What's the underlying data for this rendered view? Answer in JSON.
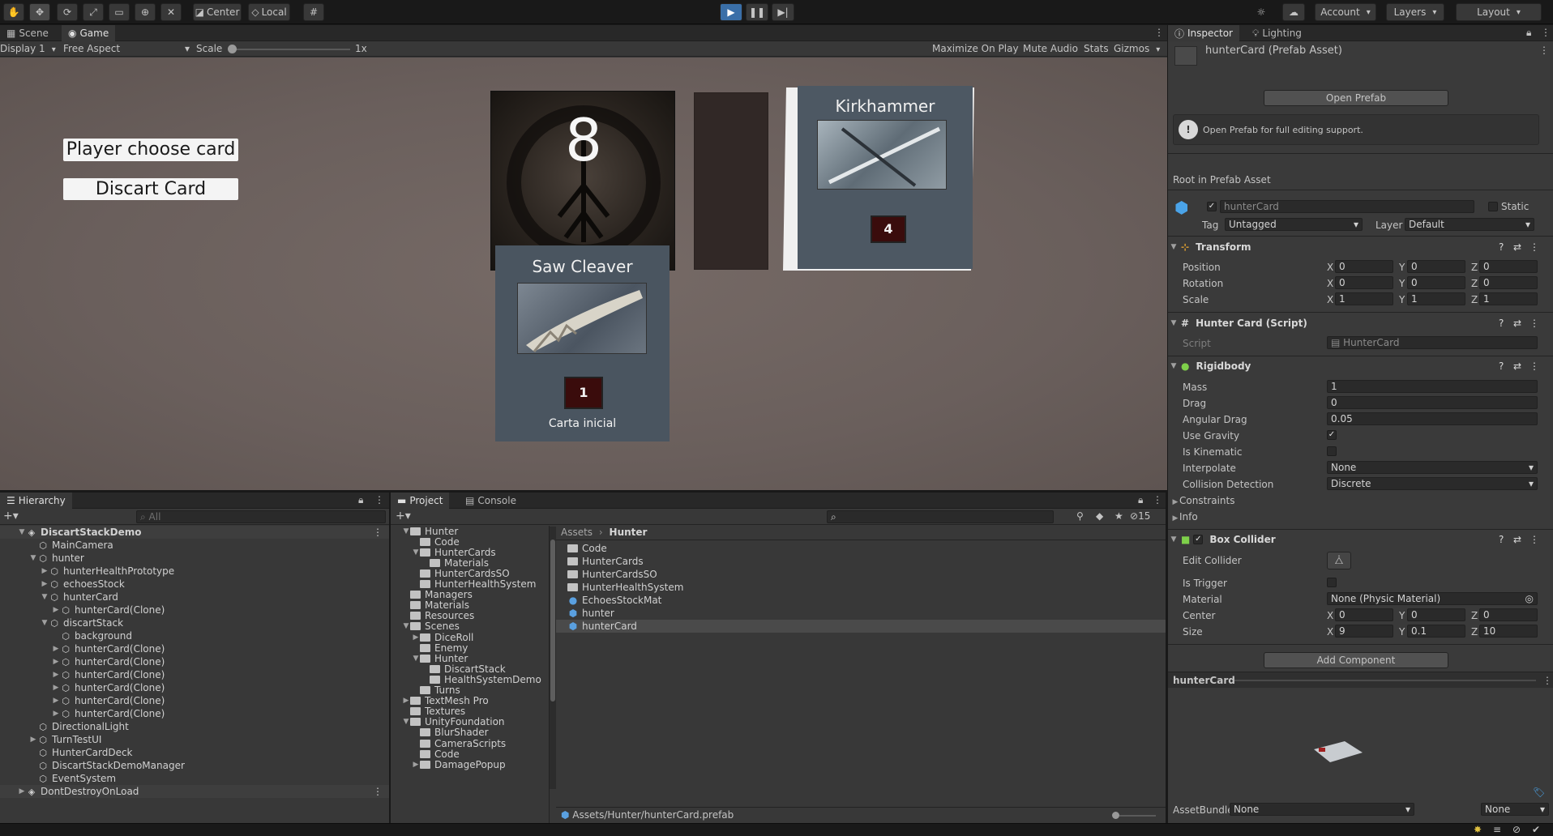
{
  "toolbar": {
    "pivot_center": "Center",
    "pivot_local": "Local",
    "account": "Account",
    "layers": "Layers",
    "layout": "Layout"
  },
  "scene_tabs": {
    "scene": "Scene",
    "game": "Game"
  },
  "game_bar": {
    "display": "Display 1",
    "aspect": "Free Aspect",
    "scale_label": "Scale",
    "scale_value": "1x",
    "maximize": "Maximize On Play",
    "mute": "Mute Audio",
    "stats": "Stats",
    "gizmos": "Gizmos"
  },
  "game_view": {
    "btn_player": "Player choose card",
    "btn_discard": "Discart Card",
    "deck_count": "8",
    "card_kirk": {
      "title": "Kirkhammer",
      "cost": "4"
    },
    "card_saw": {
      "title": "Saw Cleaver",
      "cost": "1",
      "subtitle": "Carta inicial"
    }
  },
  "hierarchy": {
    "tab": "Hierarchy",
    "search_placeholder": "All",
    "items": [
      {
        "label": "DiscartStackDemo",
        "depth": 0,
        "arrow": "▼",
        "kind": "scene",
        "bold": true
      },
      {
        "label": "MainCamera",
        "depth": 1,
        "arrow": "",
        "kind": "cube"
      },
      {
        "label": "hunter",
        "depth": 1,
        "arrow": "▼",
        "kind": "cube"
      },
      {
        "label": "hunterHealthPrototype",
        "depth": 2,
        "arrow": "▶",
        "kind": "cube"
      },
      {
        "label": "echoesStock",
        "depth": 2,
        "arrow": "▶",
        "kind": "cube"
      },
      {
        "label": "hunterCard",
        "depth": 2,
        "arrow": "▼",
        "kind": "cube"
      },
      {
        "label": "hunterCard(Clone)",
        "depth": 3,
        "arrow": "▶",
        "kind": "cube"
      },
      {
        "label": "discartStack",
        "depth": 2,
        "arrow": "▼",
        "kind": "cube"
      },
      {
        "label": "background",
        "depth": 3,
        "arrow": "",
        "kind": "cube"
      },
      {
        "label": "hunterCard(Clone)",
        "depth": 3,
        "arrow": "▶",
        "kind": "cube"
      },
      {
        "label": "hunterCard(Clone)",
        "depth": 3,
        "arrow": "▶",
        "kind": "cube"
      },
      {
        "label": "hunterCard(Clone)",
        "depth": 3,
        "arrow": "▶",
        "kind": "cube"
      },
      {
        "label": "hunterCard(Clone)",
        "depth": 3,
        "arrow": "▶",
        "kind": "cube"
      },
      {
        "label": "hunterCard(Clone)",
        "depth": 3,
        "arrow": "▶",
        "kind": "cube"
      },
      {
        "label": "hunterCard(Clone)",
        "depth": 3,
        "arrow": "▶",
        "kind": "cube"
      },
      {
        "label": "DirectionalLight",
        "depth": 1,
        "arrow": "",
        "kind": "cube"
      },
      {
        "label": "TurnTestUI",
        "depth": 1,
        "arrow": "▶",
        "kind": "cube"
      },
      {
        "label": "HunterCardDeck",
        "depth": 1,
        "arrow": "",
        "kind": "cube"
      },
      {
        "label": "DiscartStackDemoManager",
        "depth": 1,
        "arrow": "",
        "kind": "cube"
      },
      {
        "label": "EventSystem",
        "depth": 1,
        "arrow": "",
        "kind": "cube"
      },
      {
        "label": "DontDestroyOnLoad",
        "depth": 0,
        "arrow": "▶",
        "kind": "scene"
      }
    ]
  },
  "project": {
    "tab": "Project",
    "console_tab": "Console",
    "hidden_count": "15",
    "tree": [
      {
        "label": "Hunter",
        "depth": 0,
        "arrow": "▼"
      },
      {
        "label": "Code",
        "depth": 1,
        "arrow": ""
      },
      {
        "label": "HunterCards",
        "depth": 1,
        "arrow": "▼"
      },
      {
        "label": "Materials",
        "depth": 2,
        "arrow": ""
      },
      {
        "label": "HunterCardsSO",
        "depth": 1,
        "arrow": ""
      },
      {
        "label": "HunterHealthSystem",
        "depth": 1,
        "arrow": ""
      },
      {
        "label": "Managers",
        "depth": 0,
        "arrow": ""
      },
      {
        "label": "Materials",
        "depth": 0,
        "arrow": ""
      },
      {
        "label": "Resources",
        "depth": 0,
        "arrow": ""
      },
      {
        "label": "Scenes",
        "depth": 0,
        "arrow": "▼"
      },
      {
        "label": "DiceRoll",
        "depth": 1,
        "arrow": "▶"
      },
      {
        "label": "Enemy",
        "depth": 1,
        "arrow": ""
      },
      {
        "label": "Hunter",
        "depth": 1,
        "arrow": "▼"
      },
      {
        "label": "DiscartStack",
        "depth": 2,
        "arrow": ""
      },
      {
        "label": "HealthSystemDemo",
        "depth": 2,
        "arrow": ""
      },
      {
        "label": "Turns",
        "depth": 1,
        "arrow": ""
      },
      {
        "label": "TextMesh Pro",
        "depth": 0,
        "arrow": "▶"
      },
      {
        "label": "Textures",
        "depth": 0,
        "arrow": ""
      },
      {
        "label": "UnityFoundation",
        "depth": 0,
        "arrow": "▼"
      },
      {
        "label": "BlurShader",
        "depth": 1,
        "arrow": ""
      },
      {
        "label": "CameraScripts",
        "depth": 1,
        "arrow": ""
      },
      {
        "label": "Code",
        "depth": 1,
        "arrow": ""
      },
      {
        "label": "DamagePopup",
        "depth": 1,
        "arrow": "▶"
      }
    ],
    "breadcrumb": [
      "Assets",
      "Hunter"
    ],
    "assets": [
      {
        "label": "Code",
        "kind": "folder"
      },
      {
        "label": "HunterCards",
        "kind": "folder"
      },
      {
        "label": "HunterCardsSO",
        "kind": "folder"
      },
      {
        "label": "HunterHealthSystem",
        "kind": "folder"
      },
      {
        "label": "EchoesStockMat",
        "kind": "material"
      },
      {
        "label": "hunter",
        "kind": "prefab"
      },
      {
        "label": "hunterCard",
        "kind": "prefab"
      }
    ],
    "footer_path": "Assets/Hunter/hunterCard.prefab"
  },
  "inspector": {
    "tab": "Inspector",
    "lighting_tab": "Lighting",
    "asset_title": "hunterCard (Prefab Asset)",
    "open_prefab": "Open Prefab",
    "info": "Open Prefab for full editing support.",
    "root_label": "Root in Prefab Asset",
    "name": "hunterCard",
    "static": "Static",
    "tag_label": "Tag",
    "tag": "Untagged",
    "layer_label": "Layer",
    "layer": "Default",
    "transform": {
      "title": "Transform",
      "position": {
        "label": "Position",
        "x": "0",
        "y": "0",
        "z": "0"
      },
      "rotation": {
        "label": "Rotation",
        "x": "0",
        "y": "0",
        "z": "0"
      },
      "scale": {
        "label": "Scale",
        "x": "1",
        "y": "1",
        "z": "1"
      }
    },
    "script": {
      "title": "Hunter Card (Script)",
      "label": "Script",
      "value": "HunterCard"
    },
    "rigidbody": {
      "title": "Rigidbody",
      "mass_label": "Mass",
      "mass": "1",
      "drag_label": "Drag",
      "drag": "0",
      "angular_label": "Angular Drag",
      "angular": "0.05",
      "gravity_label": "Use Gravity",
      "kinematic_label": "Is Kinematic",
      "interpolate_label": "Interpolate",
      "interpolate": "None",
      "collision_label": "Collision Detection",
      "collision": "Discrete",
      "constraints": "Constraints",
      "info": "Info"
    },
    "box_collider": {
      "title": "Box Collider",
      "edit_label": "Edit Collider",
      "trigger_label": "Is Trigger",
      "material_label": "Material",
      "material": "None (Physic Material)",
      "center": {
        "label": "Center",
        "x": "0",
        "y": "0",
        "z": "0"
      },
      "size": {
        "label": "Size",
        "x": "9",
        "y": "0.1",
        "z": "10"
      }
    },
    "add_component": "Add Component",
    "preview_title": "hunterCard",
    "assetbundle_label": "AssetBundle",
    "assetbundle": "None",
    "assetbundle_variant": "None"
  }
}
